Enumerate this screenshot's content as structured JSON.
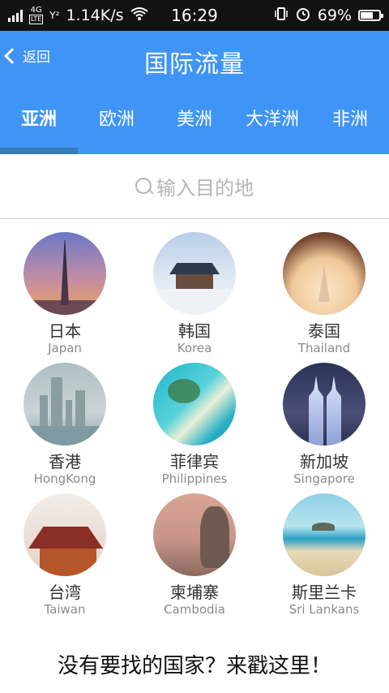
{
  "status_bar": {
    "network_type": "4G",
    "network_sub": "LTE",
    "sim2": "Y²",
    "speed": "1.14K/s",
    "time": "16:29",
    "battery": "69%",
    "battery_level": 0.69
  },
  "header": {
    "back_label": "返回",
    "title": "国际流量",
    "tabs": [
      {
        "label": "亚洲",
        "selected": true
      },
      {
        "label": "欧洲",
        "selected": false
      },
      {
        "label": "美洲",
        "selected": false
      },
      {
        "label": "大洋洲",
        "selected": false
      },
      {
        "label": "非洲",
        "selected": false
      }
    ]
  },
  "search": {
    "placeholder": "输入目的地"
  },
  "countries": [
    {
      "name": "日本",
      "en": "Japan"
    },
    {
      "name": "韩国",
      "en": "Korea"
    },
    {
      "name": "泰国",
      "en": "Thailand"
    },
    {
      "name": "香港",
      "en": "HongKong"
    },
    {
      "name": "菲律宾",
      "en": "Philippines"
    },
    {
      "name": "新加坡",
      "en": "Singapore"
    },
    {
      "name": "台湾",
      "en": "Taiwan"
    },
    {
      "name": "柬埔寨",
      "en": "Cambodia"
    },
    {
      "name": "斯里兰卡",
      "en": "Sri Lankans"
    }
  ],
  "footer": {
    "prompt": "没有要找的国家？来戳这里！"
  },
  "colors": {
    "primary": "#3f95f5",
    "indicator": "#3a7ab5",
    "status_bar": "#121212"
  }
}
